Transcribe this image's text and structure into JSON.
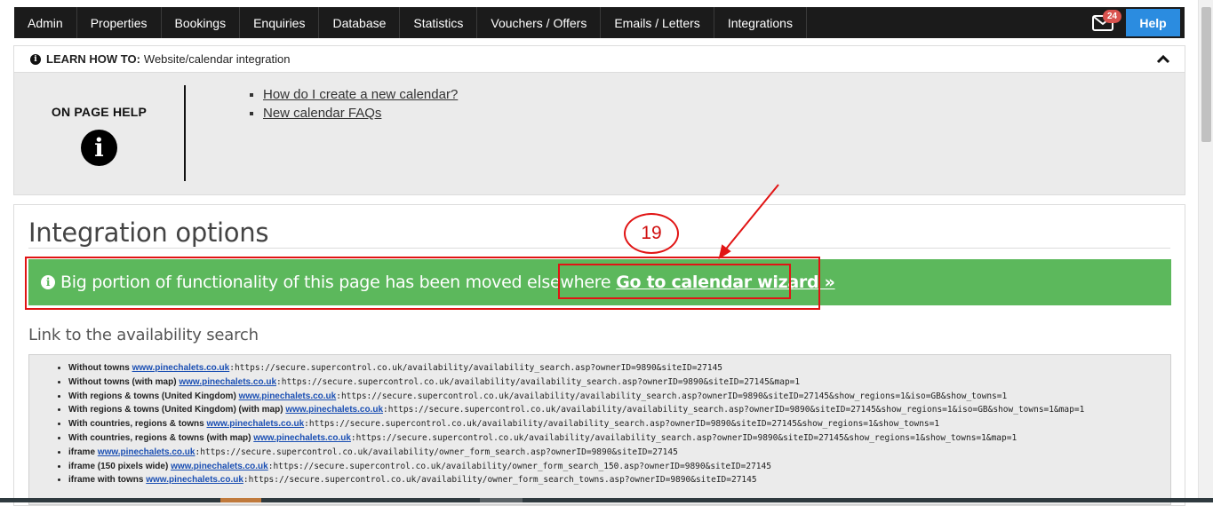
{
  "nav": {
    "items": [
      "Admin",
      "Properties",
      "Bookings",
      "Enquiries",
      "Database",
      "Statistics",
      "Vouchers / Offers",
      "Emails / Letters",
      "Integrations"
    ],
    "mail_badge": "24",
    "help_label": "Help"
  },
  "learn": {
    "prefix": "LEARN HOW TO:",
    "topic": "Website/calendar integration",
    "on_page_help": "ON PAGE HELP",
    "links": [
      "How do I create a new calendar?",
      "New calendar FAQs"
    ]
  },
  "main": {
    "title": "Integration options",
    "alert_text": "Big portion of functionality of this page has been moved elsewhere",
    "alert_link": "Go to calendar wizard »",
    "availability_heading": "Link to the availability search",
    "availability_links": [
      {
        "label": "Without towns",
        "site": "www.pinechalets.co.uk",
        "url": ":https://secure.supercontrol.co.uk/availability/availability_search.asp?ownerID=9890&siteID=27145"
      },
      {
        "label": "Without towns (with map)",
        "site": "www.pinechalets.co.uk",
        "url": ":https://secure.supercontrol.co.uk/availability/availability_search.asp?ownerID=9890&siteID=27145&map=1"
      },
      {
        "label": "With regions & towns (United Kingdom)",
        "site": "www.pinechalets.co.uk",
        "url": ":https://secure.supercontrol.co.uk/availability/availability_search.asp?ownerID=9890&siteID=27145&show_regions=1&iso=GB&show_towns=1"
      },
      {
        "label": "With regions & towns (United Kingdom) (with map)",
        "site": "www.pinechalets.co.uk",
        "url": ":https://secure.supercontrol.co.uk/availability/availability_search.asp?ownerID=9890&siteID=27145&show_regions=1&iso=GB&show_towns=1&map=1"
      },
      {
        "label": "With countries, regions & towns",
        "site": "www.pinechalets.co.uk",
        "url": ":https://secure.supercontrol.co.uk/availability/availability_search.asp?ownerID=9890&siteID=27145&show_regions=1&show_towns=1"
      },
      {
        "label": "With countries, regions & towns (with map)",
        "site": "www.pinechalets.co.uk",
        "url": ":https://secure.supercontrol.co.uk/availability/availability_search.asp?ownerID=9890&siteID=27145&show_regions=1&show_towns=1&map=1"
      },
      {
        "label": "iframe",
        "site": "www.pinechalets.co.uk",
        "url": ":https://secure.supercontrol.co.uk/availability/owner_form_search.asp?ownerID=9890&siteID=27145"
      },
      {
        "label": "iframe (150 pixels wide)",
        "site": "www.pinechalets.co.uk",
        "url": ":https://secure.supercontrol.co.uk/availability/owner_form_search_150.asp?ownerID=9890&siteID=27145"
      },
      {
        "label": "iframe with towns",
        "site": "www.pinechalets.co.uk",
        "url": ":https://secure.supercontrol.co.uk/availability/owner_form_search_towns.asp?ownerID=9890&siteID=27145"
      }
    ]
  },
  "annotation": {
    "step_number": "19"
  },
  "colors": {
    "nav_bg": "#1b1b1b",
    "help_bg": "#2b8ce0",
    "alert_bg": "#5cb85c",
    "annotation": "#e11414",
    "badge": "#d9534f"
  },
  "icons": [
    "info-icon",
    "chevron-up-icon",
    "envelope-icon",
    "arrow-icon"
  ]
}
